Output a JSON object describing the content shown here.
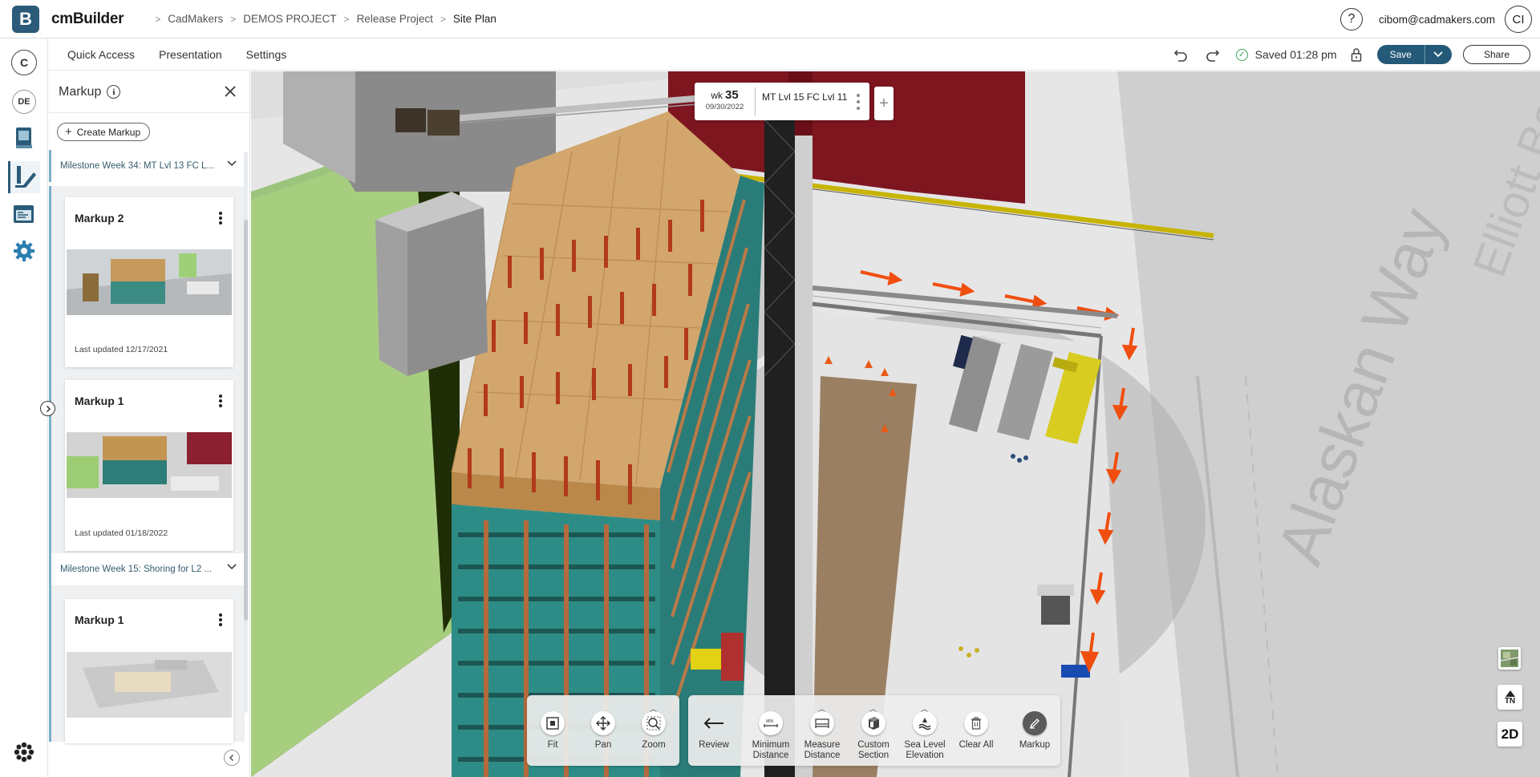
{
  "app": {
    "name": "cmBuilder",
    "logo_letter": "B",
    "brand_color": "#2b5b78"
  },
  "breadcrumb": [
    "CadMakers",
    "DEMOS PROJECT",
    "Release Project",
    "Site Plan"
  ],
  "user": {
    "help_label": "?",
    "email": "cibom@cadmakers.com",
    "initials": "CI"
  },
  "rail": {
    "company_initial": "C",
    "project_initials": "DE",
    "icons": [
      "book-icon",
      "markup-pencil-icon",
      "schedule-icon",
      "settings-gear-icon",
      "apps-flower-icon"
    ]
  },
  "subbar": {
    "tabs": [
      "Quick Access",
      "Presentation",
      "Settings"
    ],
    "saved_status": "Saved 01:28 pm",
    "save_label": "Save",
    "share_label": "Share"
  },
  "panel": {
    "title": "Markup",
    "create_label": "Create Markup",
    "groups": [
      {
        "title": "Milestone Week 34: MT Lvl 13 FC L...",
        "cards": [
          {
            "title": "Markup 2",
            "updated": "Last updated 12/17/2021"
          },
          {
            "title": "Markup 1",
            "updated": "Last updated 01/18/2022"
          }
        ]
      },
      {
        "title": "Milestone Week 15: Shoring for L2 ...",
        "cards": [
          {
            "title": "Markup 1",
            "updated": ""
          }
        ]
      }
    ]
  },
  "week_chip": {
    "wk_prefix": "wk",
    "wk_number": "35",
    "date": "09/30/2022",
    "label": "MT Lvl 15 FC Lvl 11",
    "add_label": "+"
  },
  "scene": {
    "street_labels": [
      "Elliott Bay T",
      "Alaskan Way"
    ]
  },
  "toolbar_nav": [
    {
      "label": "Fit",
      "icon": "fit-icon"
    },
    {
      "label": "Pan",
      "icon": "pan-icon"
    },
    {
      "label": "Zoom",
      "icon": "zoom-icon"
    }
  ],
  "toolbar_tools": [
    {
      "label": "Review",
      "icon": "back-arrow-icon"
    },
    {
      "label": "Minimum Distance",
      "icon": "min-distance-icon"
    },
    {
      "label": "Measure Distance",
      "icon": "measure-distance-icon"
    },
    {
      "label": "Custom Section",
      "icon": "section-box-icon"
    },
    {
      "label": "Sea Level Elevation",
      "icon": "elevation-icon"
    },
    {
      "label": "Clear All",
      "icon": "trash-icon"
    },
    {
      "label": "Markup",
      "icon": "markup-pencil-icon"
    }
  ],
  "right_tools": {
    "satellite": "satellite-map-icon",
    "north_label": "TN",
    "view_mode": "2D"
  }
}
